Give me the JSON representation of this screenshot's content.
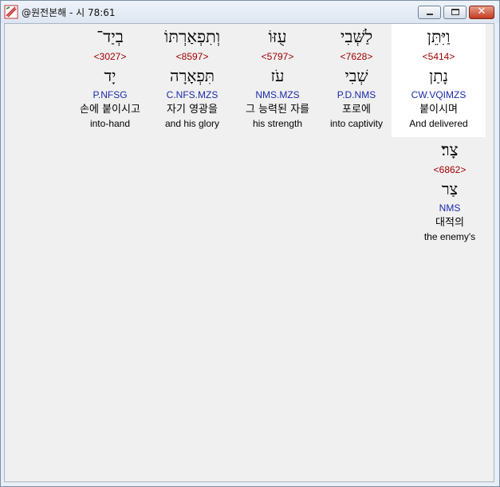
{
  "window": {
    "title": "@원전본해 - 시 78:61",
    "icon": "bible-app-icon",
    "controls": {
      "minimize": "minimize-icon",
      "maximize": "maximize-icon",
      "close": "✕"
    }
  },
  "words": [
    {
      "hebrew": "וַיִּתֵּן",
      "strong": "<5414>",
      "lemma": "נָתַן",
      "parse": "CW.VQIMZS",
      "korean": "붙이시며",
      "english": "And delivered",
      "selected": true
    },
    {
      "hebrew": "לַשְּׁבִי",
      "strong": "<7628>",
      "lemma": "שְׁבִי",
      "parse": "P.D.NMS",
      "korean": "포로에",
      "english": "into captivity"
    },
    {
      "hebrew": "עֻזּוֹ",
      "strong": "<5797>",
      "lemma": "עֹז",
      "parse": "NMS.MZS",
      "korean": "그 능력된 자를",
      "english": "his strength"
    },
    {
      "hebrew": "וְתִפְאַרְתּוֹ",
      "strong": "<8597>",
      "lemma": "תִּפְאָרָה",
      "parse": "C.NFS.MZS",
      "korean": "자기 영광을",
      "english": "and his glory"
    },
    {
      "hebrew": "בְיַד־",
      "strong": "<3027>",
      "lemma": "יָד",
      "parse": "P.NFSG",
      "korean": "손에 붙이시고",
      "english": "into-hand"
    },
    {
      "hebrew": "צָר׃",
      "strong": "<6862>",
      "lemma": "צַר",
      "parse": "NMS",
      "korean": "대적의",
      "english": "the enemy's"
    }
  ]
}
